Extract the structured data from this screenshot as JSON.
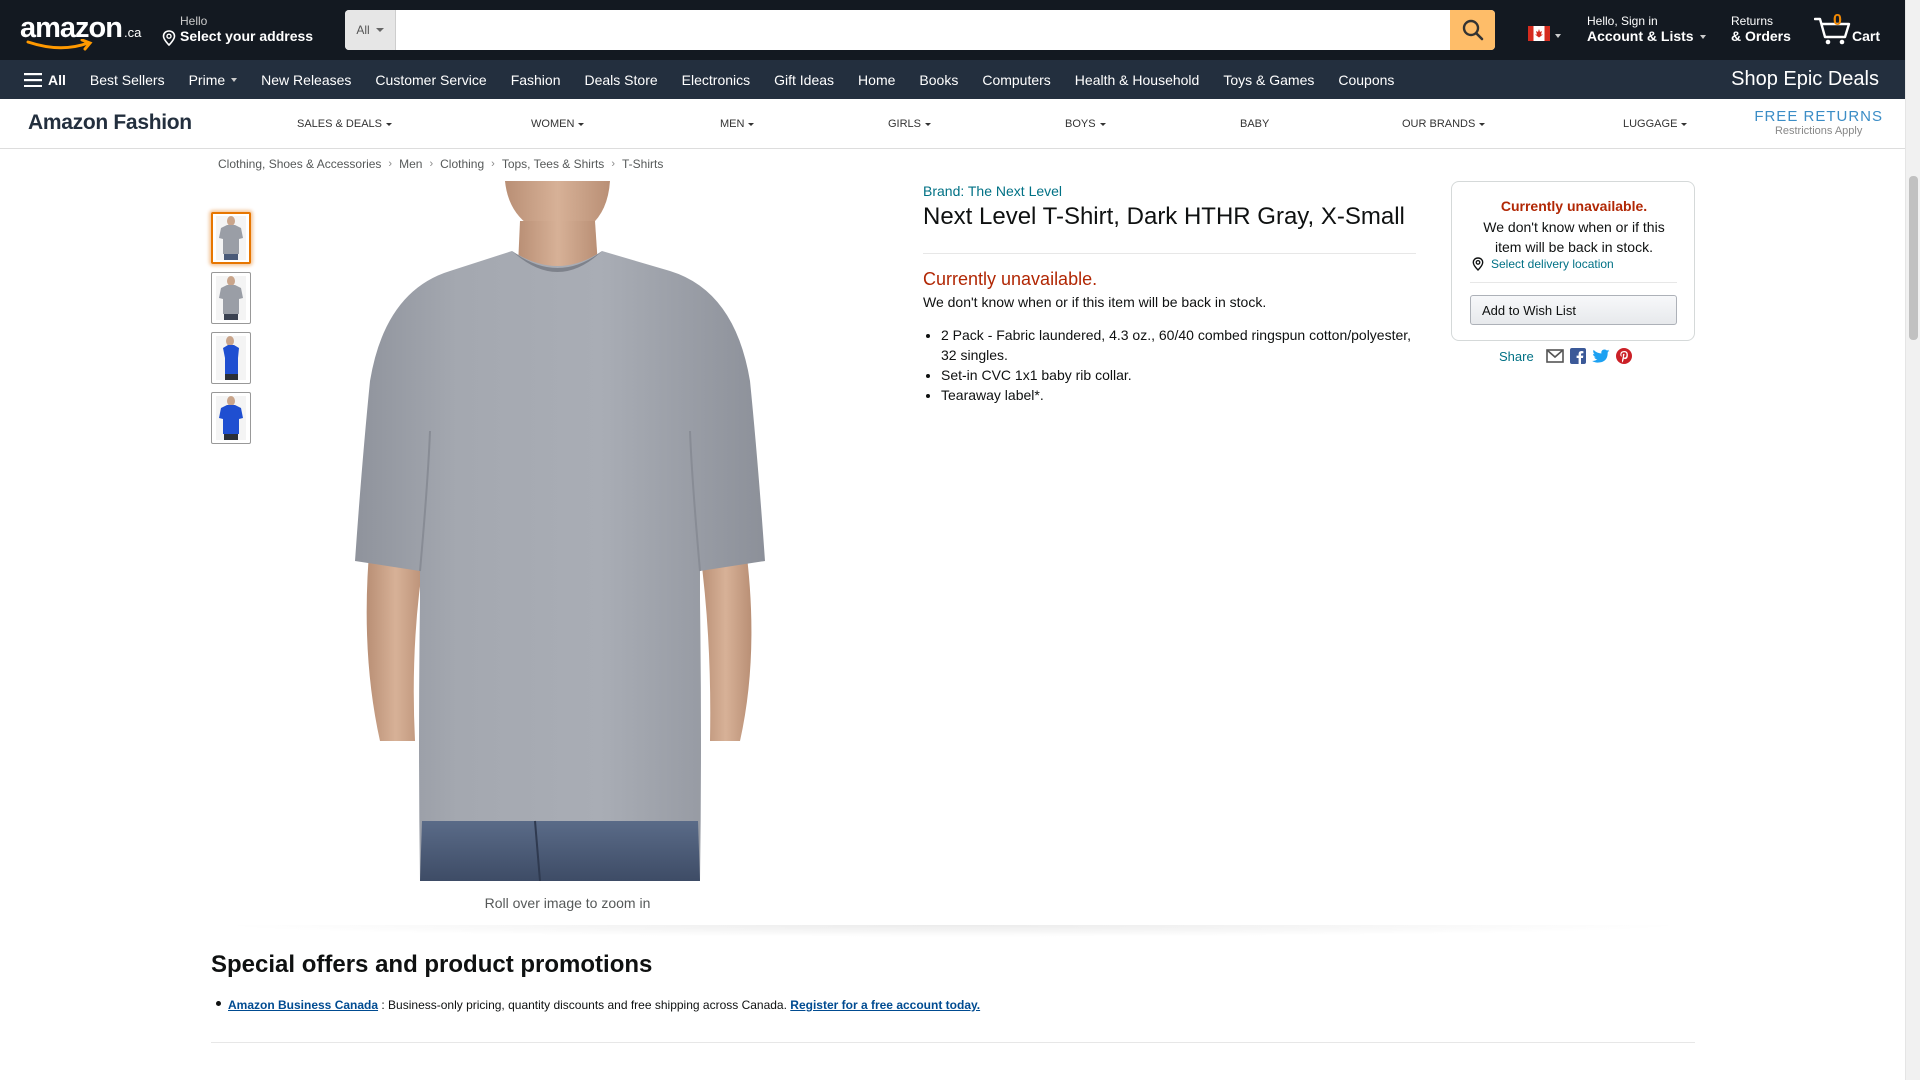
{
  "header": {
    "logo_word": "amazon",
    "logo_tld": ".ca",
    "address_line1": "Hello",
    "address_line2": "Select your address",
    "search_category": "All",
    "search_placeholder": "",
    "account_line1": "Hello, Sign in",
    "account_line2": "Account & Lists",
    "returns_line1": "Returns",
    "returns_line2": "& Orders",
    "cart_count": "0",
    "cart_label": "Cart",
    "flag_icon": "canada-flag-icon",
    "accent_color": "#febd69"
  },
  "subnav": {
    "all_label": "All",
    "items": [
      "Best Sellers",
      "Prime",
      "New Releases",
      "Customer Service",
      "Fashion",
      "Deals Store",
      "Electronics",
      "Gift Ideas",
      "Home",
      "Books",
      "Computers",
      "Health & Household",
      "Toys & Games",
      "Coupons"
    ],
    "promo": "Shop Epic Deals"
  },
  "fashion_bar": {
    "brand": "Amazon Fashion",
    "items": [
      "SALES & DEALS",
      "WOMEN",
      "MEN",
      "GIRLS",
      "BOYS",
      "BABY",
      "OUR BRANDS",
      "LUGGAGE"
    ],
    "free_returns": "FREE RETURNS",
    "restrictions": "Restrictions Apply"
  },
  "breadcrumb": [
    "Clothing, Shoes & Accessories",
    "Men",
    "Clothing",
    "Tops, Tees & Shirts",
    "T-Shirts"
  ],
  "gallery": {
    "zoom_hint": "Roll over image to zoom in",
    "thumbnail_colors": [
      "#9a9ea6",
      "#9a9ea6",
      "#1f4fd1",
      "#1f4fd1"
    ]
  },
  "product": {
    "brand_link": "Brand: The Next Level",
    "title": "Next Level T-Shirt, Dark HTHR Gray, X-Small",
    "availability": "Currently unavailable.",
    "availability_sub": "We don't know when or if this item will be back in stock.",
    "bullets": [
      "2 Pack - Fabric laundered, 4.3 oz., 60/40 combed ringspun cotton/polyester, 32 singles.",
      "Set-in CVC 1x1 baby rib collar.",
      "Tearaway label*."
    ]
  },
  "buybox": {
    "unavailable": "Currently unavailable.",
    "text": "We don't know when or if this item will be back in stock.",
    "delivery_link": "Select delivery location",
    "wishlist_button": "Add to Wish List",
    "share_label": "Share"
  },
  "promotions": {
    "heading": "Special offers and product promotions",
    "link1": "Amazon Business Canada",
    "text": " : Business-only pricing, quantity discounts and free shipping across Canada. ",
    "link2": "Register for a free account today."
  }
}
